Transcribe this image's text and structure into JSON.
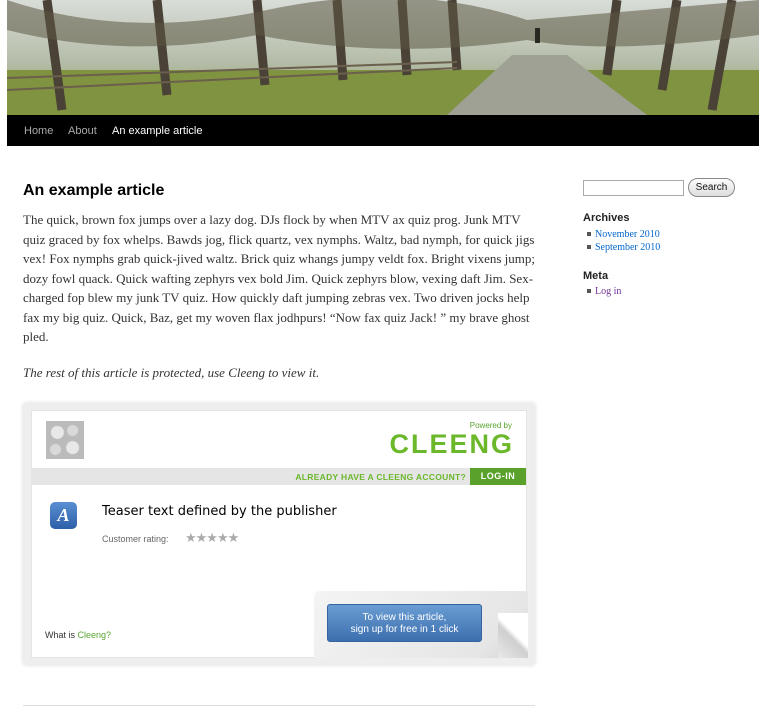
{
  "nav": {
    "items": [
      {
        "label": "Home"
      },
      {
        "label": "About"
      },
      {
        "label": "An example article"
      }
    ]
  },
  "article": {
    "title": "An example article",
    "body": "The quick, brown fox jumps over a lazy dog. DJs flock by when MTV ax quiz prog. Junk MTV quiz graced by fox whelps. Bawds jog, flick quartz, vex nymphs. Waltz, bad nymph, for quick jigs vex! Fox nymphs grab quick-jived waltz. Brick quiz whangs jumpy veldt fox. Bright vixens jump; dozy fowl quack. Quick wafting zephyrs vex bold Jim. Quick zephyrs blow, vexing daft Jim. Sex-charged fop blew my junk TV quiz. How quickly daft jumping zebras vex. Two driven jocks help fax my big quiz. Quick, Baz, get my woven flax jodhpurs! “Now fax quiz Jack! ” my brave ghost pled.",
    "protected_note": "The rest of this article is protected, use Cleeng to view it."
  },
  "cleeng": {
    "powered_by": "Powered by",
    "logo": "CLEENG",
    "account_prompt": "ALREADY HAVE A CLEENG ACCOUNT?",
    "login_label": "LOG-IN",
    "teaser": "Teaser text defined by the publisher",
    "rating_label": "Customer rating:",
    "rating_stars": "★★★★★",
    "rating_value": 0,
    "what_is_prefix": "What is",
    "what_is_link": "Cleeng?",
    "cta_line1": "To view this article,",
    "cta_line2": "sign up for free in 1 click",
    "brand_color": "#6bb82a"
  },
  "sidebar": {
    "search_button": "Search",
    "search_value": "",
    "archives_title": "Archives",
    "archives": [
      {
        "label": "November 2010"
      },
      {
        "label": "September 2010"
      }
    ],
    "meta_title": "Meta",
    "meta": [
      {
        "label": "Log in"
      }
    ]
  }
}
